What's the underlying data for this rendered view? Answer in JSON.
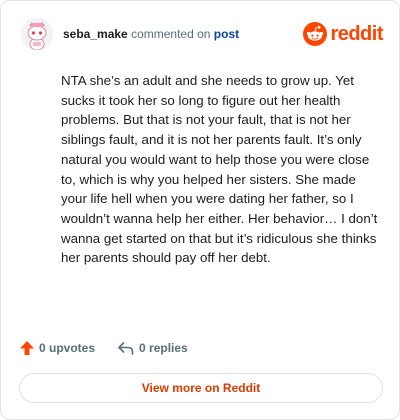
{
  "header": {
    "username": "seba_make",
    "action_text": "commented on",
    "post_link": "post",
    "brand": "reddit"
  },
  "comment": {
    "body": "NTA she’s an adult and she needs to grow up. Yet sucks it took her so long to figure out her health problems. But that is not your fault, that is not her siblings fault, and it is not her parents fault. It’s only natural you would want to help those you were close to, which is why you helped her sisters. She made your life hell when you were dating her father, so I wouldn’t wanna help her either. Her behavior… I don’t wanna get started on that but it’s ridiculous she thinks her parents should pay off her debt."
  },
  "actions": {
    "upvotes_label": "0 upvotes",
    "replies_label": "0 replies"
  },
  "footer": {
    "view_more_label": "View more on Reddit"
  },
  "colors": {
    "brand_orange": "#ff4500",
    "link_blue": "#0a449b",
    "muted_text": "#576f76",
    "view_more_text": "#d93a00"
  },
  "icons": {
    "avatar": "snoo-avatar-pink",
    "logo": "reddit-snoo-icon",
    "upvote": "upvote-arrow-icon",
    "reply": "reply-arrow-icon"
  }
}
